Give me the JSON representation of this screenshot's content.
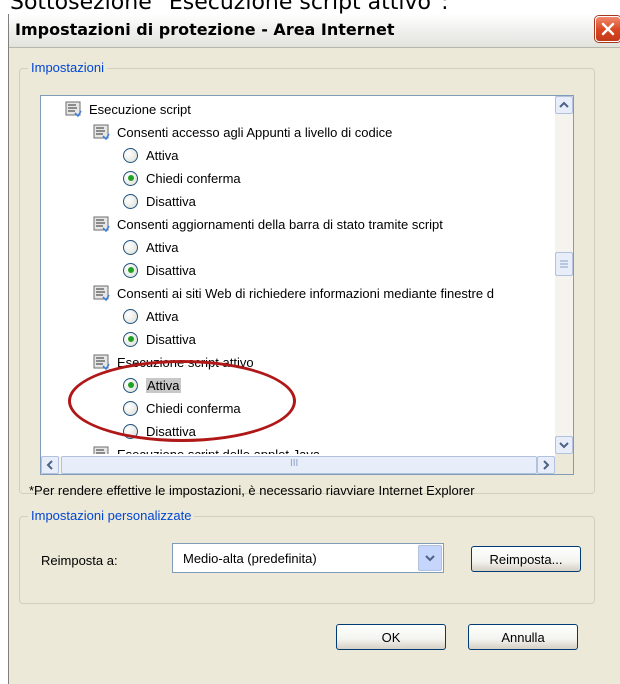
{
  "caption": "Sottosezione \"Esecuzione script attivo\":",
  "window": {
    "title": "Impostazioni di protezione - Area Internet",
    "close_icon": "close-icon"
  },
  "settings_group": {
    "legend": "Impostazioni",
    "tree": {
      "root": "Esecuzione script",
      "items": [
        {
          "label": "Consenti accesso agli Appunti a livello di codice",
          "options": [
            {
              "label": "Attiva",
              "checked": false
            },
            {
              "label": "Chiedi conferma",
              "checked": true
            },
            {
              "label": "Disattiva",
              "checked": false
            }
          ]
        },
        {
          "label": "Consenti aggiornamenti della barra di stato tramite script",
          "options": [
            {
              "label": "Attiva",
              "checked": false
            },
            {
              "label": "Disattiva",
              "checked": true
            }
          ]
        },
        {
          "label": "Consenti ai siti Web di richiedere informazioni mediante finestre d",
          "options": [
            {
              "label": "Attiva",
              "checked": false
            },
            {
              "label": "Disattiva",
              "checked": true
            }
          ]
        },
        {
          "label": "Esecuzione script attivo",
          "options": [
            {
              "label": "Attiva",
              "checked": true,
              "selected": true
            },
            {
              "label": "Chiedi conferma",
              "checked": false
            },
            {
              "label": "Disattiva",
              "checked": false
            }
          ]
        },
        {
          "label": "Esecuzione script delle applet Java",
          "options": []
        }
      ]
    },
    "hscroll_grip": "III"
  },
  "note": "*Per rendere effettive le impostazioni, è necessario riavviare Internet Explorer",
  "custom_group": {
    "legend": "Impostazioni personalizzate",
    "reset_label": "Reimposta a:",
    "combo_value": "Medio-alta (predefinita)",
    "reset_button": "Reimposta..."
  },
  "buttons": {
    "ok": "OK",
    "cancel": "Annulla"
  },
  "colors": {
    "accent_blue": "#0046d5",
    "annotation_red": "#b01818",
    "radio_checked": "#21a121",
    "dialog_bg": "#ece9d8"
  }
}
